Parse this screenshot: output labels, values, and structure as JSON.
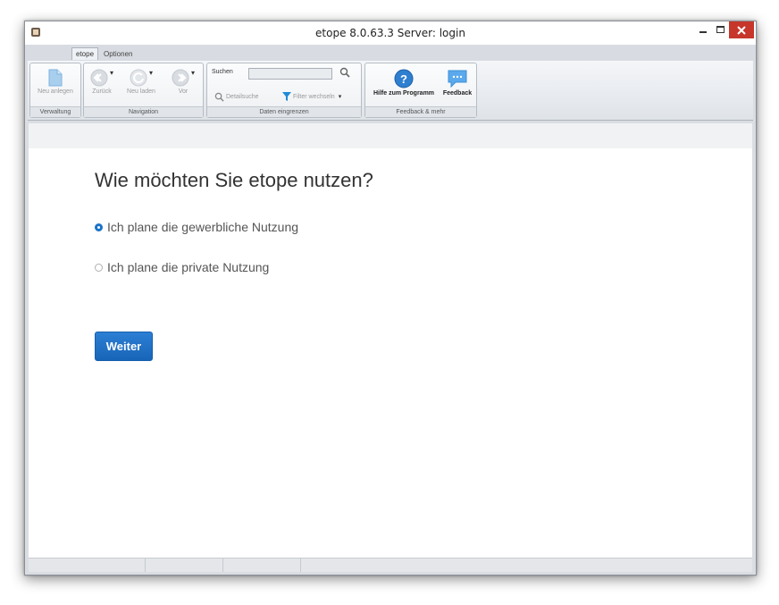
{
  "window": {
    "title": "etope 8.0.63.3 Server: login"
  },
  "tabs": [
    {
      "label": "etope"
    },
    {
      "label": "Optionen"
    }
  ],
  "ribbon": {
    "verwaltung": {
      "label": "Verwaltung",
      "new": "Neu anlegen"
    },
    "navigation": {
      "label": "Navigation",
      "back": "Zurück",
      "reload": "Neu laden",
      "forward": "Vor"
    },
    "filter": {
      "label": "Daten eingrenzen",
      "search_label": "Suchen",
      "search_value": "",
      "detail": "Detailsuche",
      "switch": "Filter wechseln"
    },
    "feedback": {
      "label": "Feedback & mehr",
      "help": "Hilfe zum Programm",
      "feedback": "Feedback"
    }
  },
  "main": {
    "heading": "Wie möchten Sie etope nutzen?",
    "options": [
      {
        "label": "Ich plane die gewerbliche Nutzung",
        "selected": true
      },
      {
        "label": "Ich plane die private Nutzung",
        "selected": false
      }
    ],
    "continue": "Weiter"
  },
  "colors": {
    "accent": "#1a73c9",
    "close": "#c7362b"
  },
  "icons": [
    "app-icon",
    "document-icon",
    "back-icon",
    "reload-icon",
    "forward-icon",
    "search-icon",
    "detail-search-icon",
    "filter-icon",
    "help-icon",
    "feedback-icon"
  ]
}
